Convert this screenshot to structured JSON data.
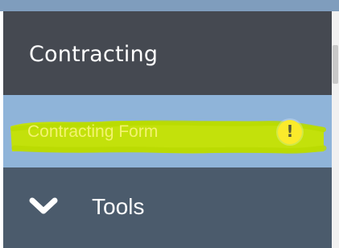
{
  "sidebar": {
    "section_title": "Contracting",
    "items": [
      {
        "label": "Contracting Form",
        "status_icon": "warning-exclamation-icon",
        "status_text": "!",
        "highlight_color": "#c6e400",
        "label_color": "#f3f36f",
        "state": "selected"
      },
      {
        "label": "Tools",
        "icon": "chevron-down-icon",
        "state": "collapsed"
      }
    ]
  },
  "colors": {
    "section_header_bg": "#454951",
    "selected_item_bg": "#8fb4d9",
    "nav_item_bg": "#4b5b6c",
    "warning_badge": "#fbea2b",
    "text": "#ffffff"
  }
}
